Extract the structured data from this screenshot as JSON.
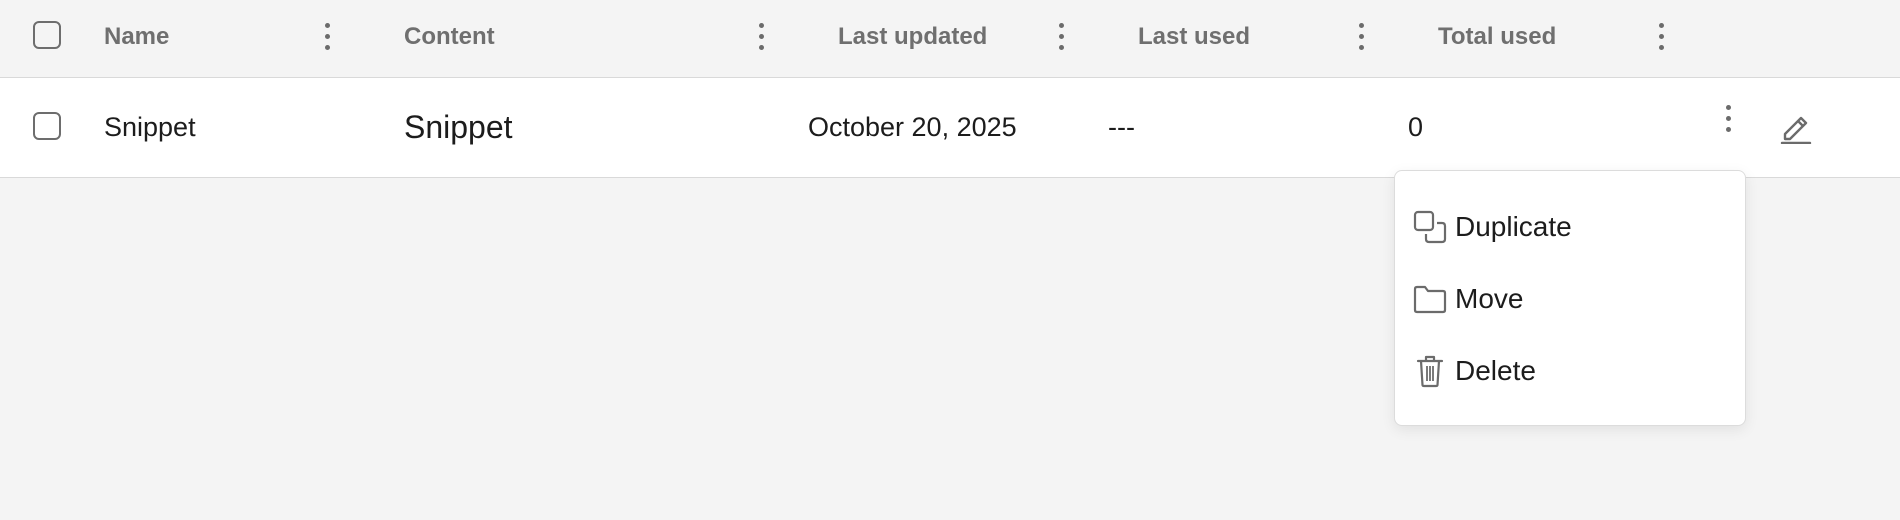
{
  "columns": {
    "name": "Name",
    "content": "Content",
    "last_updated": "Last updated",
    "last_used": "Last used",
    "total_used": "Total used"
  },
  "row": {
    "name": "Snippet",
    "content": "Snippet",
    "last_updated": "October 20, 2025",
    "last_used": "---",
    "total_used": "0"
  },
  "menu": {
    "items": [
      {
        "label": "Duplicate",
        "icon": "duplicate-icon"
      },
      {
        "label": "Move",
        "icon": "folder-icon"
      },
      {
        "label": "Delete",
        "icon": "trash-icon"
      }
    ]
  },
  "icons": {
    "row_actions": "kebab-icon",
    "edit": "pencil-icon"
  },
  "colors": {
    "header_bg": "#f4f4f4",
    "row_bg": "#ffffff",
    "header_text": "#6f6f6f",
    "body_text": "#1c1c1c",
    "icon": "#6b6b6b"
  }
}
